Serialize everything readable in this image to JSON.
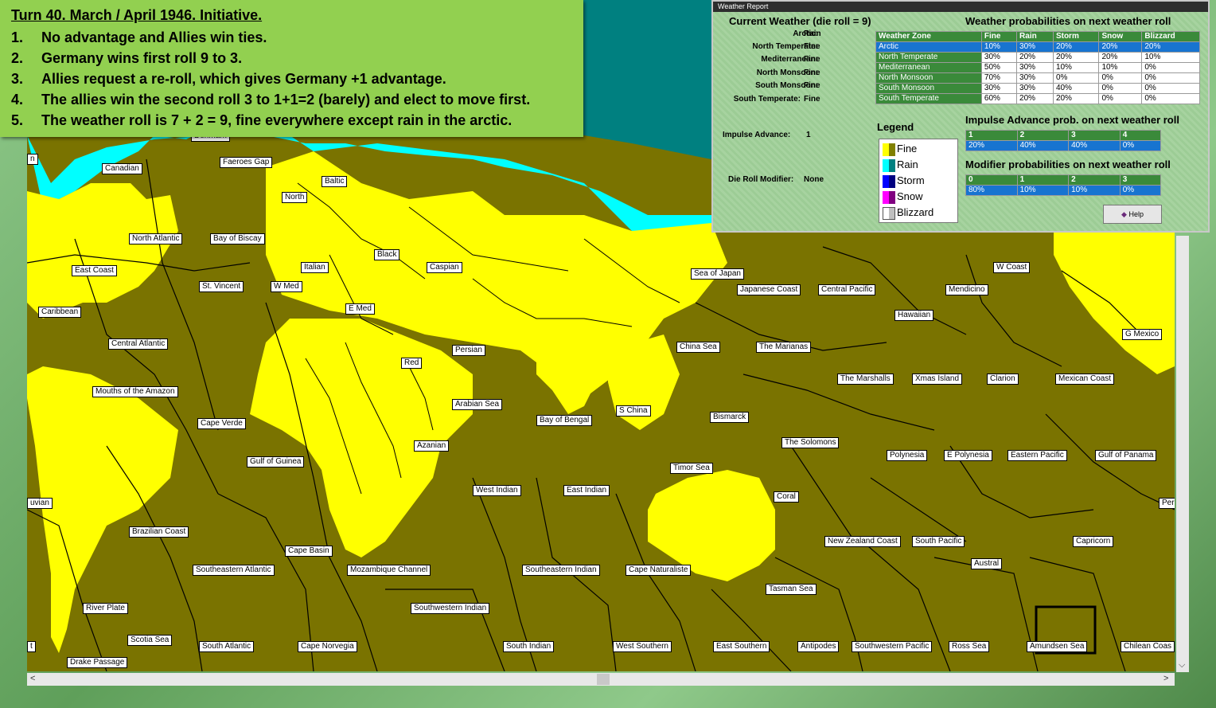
{
  "note": {
    "title": "Turn  40.  March / April 1946.  Initiative.",
    "items": [
      {
        "num": "1.",
        "text": "No advantage and Allies win ties."
      },
      {
        "num": "2.",
        "text": "Germany wins first roll 9 to 3."
      },
      {
        "num": "3.",
        "text": "Allies request a re-roll, which gives Germany +1 advantage."
      },
      {
        "num": "4.",
        "text": "The allies win the second roll 3 to 1+1=2 (barely) and elect to move first."
      },
      {
        "num": "5.",
        "text": "The weather roll is 7 + 2 = 9, fine everywhere except rain in the arctic."
      }
    ]
  },
  "weather_report": {
    "window_title": "Weather Report",
    "current_heading": "Current Weather (die roll = 9)",
    "current": [
      {
        "zone": "Arctic:",
        "value": "Rain"
      },
      {
        "zone": "North Temperate:",
        "value": "Fine"
      },
      {
        "zone": "Mediterranean:",
        "value": "Fine"
      },
      {
        "zone": "North Monsoon:",
        "value": "Fine"
      },
      {
        "zone": "South Monsoon:",
        "value": "Fine"
      },
      {
        "zone": "South Temperate:",
        "value": "Fine"
      }
    ],
    "impulse_advance_label": "Impulse Advance:",
    "impulse_advance_value": "1",
    "die_roll_modifier_label": "Die Roll Modifier:",
    "die_roll_modifier_value": "None",
    "prob_heading": "Weather probabilities on next weather roll",
    "prob_columns": [
      "Weather Zone",
      "Fine",
      "Rain",
      "Storm",
      "Snow",
      "Blizzard"
    ],
    "prob_rows": [
      [
        "Arctic",
        "10%",
        "30%",
        "20%",
        "20%",
        "20%"
      ],
      [
        "North Temperate",
        "30%",
        "20%",
        "20%",
        "20%",
        "10%"
      ],
      [
        "Mediterranean",
        "50%",
        "30%",
        "10%",
        "10%",
        "0%"
      ],
      [
        "North Monsoon",
        "70%",
        "30%",
        "0%",
        "0%",
        "0%"
      ],
      [
        "South Monsoon",
        "30%",
        "30%",
        "40%",
        "0%",
        "0%"
      ],
      [
        "South Temperate",
        "60%",
        "20%",
        "20%",
        "0%",
        "0%"
      ]
    ],
    "legend_heading": "Legend",
    "legend": [
      {
        "label": "Fine",
        "c1": "#ffff00",
        "c2": "#808000"
      },
      {
        "label": "Rain",
        "c1": "#00ffff",
        "c2": "#008080"
      },
      {
        "label": "Storm",
        "c1": "#0000ff",
        "c2": "#000080"
      },
      {
        "label": "Snow",
        "c1": "#ff00ff",
        "c2": "#800080"
      },
      {
        "label": "Blizzard",
        "c1": "#ffffff",
        "c2": "#c0c0c0"
      }
    ],
    "impulse_heading": "Impulse Advance prob. on next weather roll",
    "impulse_cols": [
      "1",
      "2",
      "3",
      "4"
    ],
    "impulse_vals": [
      "20%",
      "40%",
      "40%",
      "0%"
    ],
    "modifier_heading": "Modifier probabilities on next weather roll",
    "modifier_cols": [
      "0",
      "1",
      "2",
      "3"
    ],
    "modifier_vals": [
      "80%",
      "10%",
      "10%",
      "0%"
    ],
    "help_label": "Help"
  },
  "map_labels": {
    "denmark": "Denmark",
    "canadian": "Canadian",
    "faeroes_gap": "Faeroes Gap",
    "baltic": "Baltic",
    "north": "North",
    "north_atlantic": "North Atlantic",
    "bay_of_biscay": "Bay of Biscay",
    "black": "Black",
    "italian": "Italian",
    "caspian": "Caspian",
    "east_coast": "East Coast",
    "st_vincent": "St. Vincent",
    "w_med": "W Med",
    "e_med": "E Med",
    "caribbean": "Caribbean",
    "central_atlantic": "Central Atlantic",
    "persian": "Persian",
    "red": "Red",
    "mouths_of_the_amazon": "Mouths of the Amazon",
    "arabian_sea": "Arabian Sea",
    "cape_verde": "Cape Verde",
    "azanian": "Azanian",
    "gulf_of_guinea": "Gulf of Guinea",
    "bay_of_bengal": "Bay of Bengal",
    "s_china": "S China",
    "west_indian": "West Indian",
    "east_indian": "East Indian",
    "peruvian": "uvian",
    "brazilian_coast": "Brazilian Coast",
    "cape_basin": "Cape Basin",
    "southeastern_atlantic": "Southeastern Atlantic",
    "mozambique_channel": "Mozambique Channel",
    "southeastern_indian": "Southeastern Indian",
    "cape_naturaliste": "Cape Naturaliste",
    "southwestern_indian": "Southwestern Indian",
    "river_plate": "River Plate",
    "scotia_sea": "Scotia Sea",
    "south_atlantic": "South Atlantic",
    "cape_norvegia": "Cape Norvegia",
    "south_indian": "South Indian",
    "west_southern": "West Southern",
    "east_southern": "East Southern",
    "antipodes": "Antipodes",
    "southwestern_pacific": "Southwestern Pacific",
    "ross_sea": "Ross Sea",
    "amundsen_sea": "Amundsen Sea",
    "chilean_coast": "Chilean Coas",
    "drake_passage": "Drake Passage",
    "sea_of_japan": "Sea of Japan",
    "japanese_coast": "Japanese Coast",
    "central_pacific": "Central Pacific",
    "w_coast": "W Coast",
    "mendicino": "Mendicino",
    "hawaiian": "Hawaiian",
    "china_sea": "China Sea",
    "the_marianas": "The Marianas",
    "g_mexico": "G Mexico",
    "the_marshalls": "The Marshalls",
    "xmas_island": "Xmas Island",
    "clarion": "Clarion",
    "mexican_coast": "Mexican Coast",
    "bismarck": "Bismarck",
    "the_solomons": "The Solomons",
    "timor_sea": "Timor Sea",
    "polynesia": "Polynesia",
    "e_polynesia": "E Polynesia",
    "eastern_pacific": "Eastern Pacific",
    "gulf_of_panama": "Gulf of Panama",
    "coral": "Coral",
    "peru": "Per",
    "new_zealand_coast": "New Zealand Coast",
    "south_pacific": "South Pacific",
    "capricorn": "Capricorn",
    "austral": "Austral",
    "tasman_sea": "Tasman Sea",
    "left_edge": "t",
    "left_edge2": "n"
  },
  "colors": {
    "fine_land": "#ffff00",
    "fine_sea": "#7a7300",
    "rain_land": "#00ffff",
    "rain_sea": "#008080",
    "note_bg": "#92d050"
  }
}
